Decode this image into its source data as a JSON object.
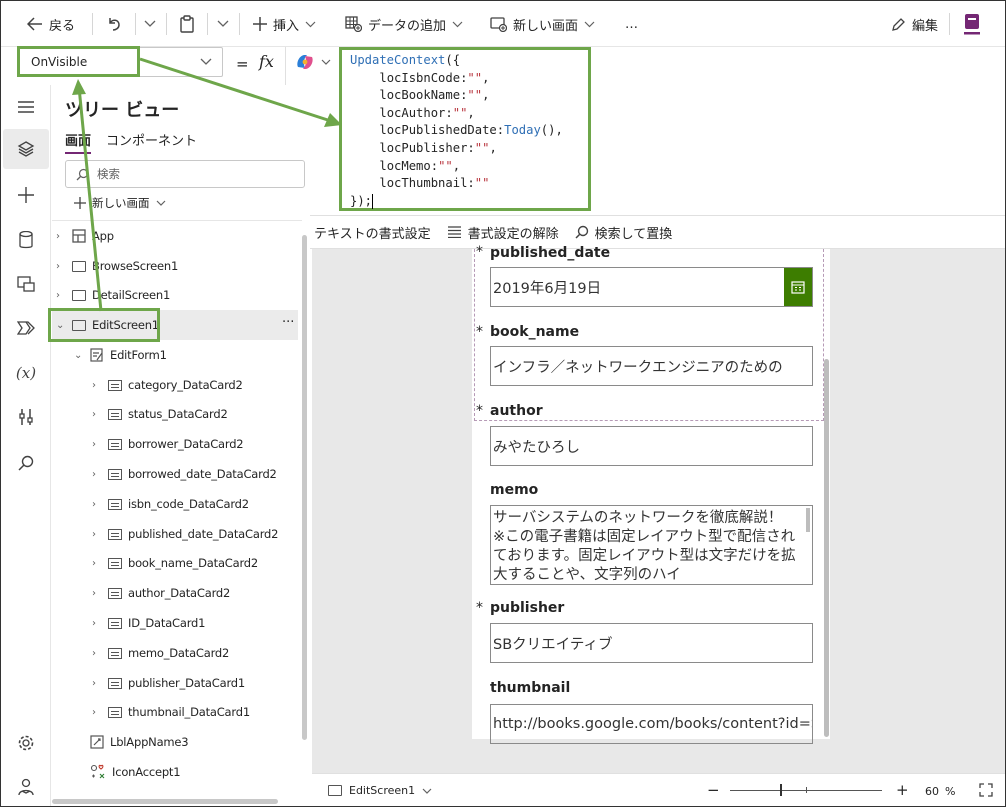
{
  "commandbar": {
    "back": "戻る",
    "insert": "挿入",
    "add_data": "データの追加",
    "new_screen": "新しい画面",
    "more": "…",
    "edit": "編集"
  },
  "formula": {
    "property": "OnVisible",
    "fx": "fx",
    "lines": [
      {
        "fn": "UpdateContext",
        "rest": "({"
      },
      {
        "indent": "    ",
        "key": "locIsbnCode:",
        "val": "\"\"",
        "tail": ","
      },
      {
        "indent": "    ",
        "key": "locBookName:",
        "val": "\"\"",
        "tail": ","
      },
      {
        "indent": "    ",
        "key": "locAuthor:",
        "val": "\"\"",
        "tail": ","
      },
      {
        "indent": "    ",
        "key": "locPublishedDate:",
        "fnval": "Today",
        "tail": "(),"
      },
      {
        "indent": "    ",
        "key": "locPublisher:",
        "val": "\"\"",
        "tail": ","
      },
      {
        "indent": "    ",
        "key": "locMemo:",
        "val": "\"\"",
        "tail": ","
      },
      {
        "indent": "    ",
        "key": "locThumbnail:",
        "val": "\"\"",
        "tail": ""
      },
      {
        "rest": "});"
      }
    ]
  },
  "format_toolbar": {
    "format_text": "テキストの書式設定",
    "remove_format": "書式設定の解除",
    "find_replace": "検索して置換"
  },
  "tree": {
    "title": "ツリー ビュー",
    "tab_screens": "画面",
    "tab_components": "コンポーネント",
    "search_placeholder": "検索",
    "new_screen": "新しい画面",
    "more": "···",
    "nodes": {
      "app": "App",
      "browse": "BrowseScreen1",
      "detail": "DetailScreen1",
      "edit": "EditScreen1",
      "form": "EditForm1",
      "c1": "category_DataCard2",
      "c2": "status_DataCard2",
      "c3": "borrower_DataCard2",
      "c4": "borrowed_date_DataCard2",
      "c5": "isbn_code_DataCard2",
      "c6": "published_date_DataCard2",
      "c7": "book_name_DataCard2",
      "c8": "author_DataCard2",
      "c9": "ID_DataCard1",
      "c10": "memo_DataCard2",
      "c11": "publisher_DataCard1",
      "c12": "thumbnail_DataCard1",
      "lbl": "LblAppName3",
      "icon": "IconAccept1"
    }
  },
  "form": {
    "required_mark": "*",
    "published_date_label": "published_date",
    "published_date_value": "2019年6月19日",
    "book_name_label": "book_name",
    "book_name_value": "インフラ／ネットワークエンジニアのための",
    "author_label": "author",
    "author_value": "みやたひろし",
    "memo_label": "memo",
    "memo_value": "サーバシステムのネットワークを徹底解説！ ※この電子書籍は固定レイアウト型で配信されております。固定レイアウト型は文字だけを拡大することや、文字列のハイ",
    "publisher_label": "publisher",
    "publisher_value": "SBクリエイティブ",
    "thumbnail_label": "thumbnail",
    "thumbnail_value": "http://books.google.com/books/content?id=S"
  },
  "status": {
    "screen": "EditScreen1",
    "minus": "−",
    "plus": "+",
    "zoom": "60",
    "percent": "%"
  },
  "colors": {
    "highlight": "#6ea64a",
    "accent": "#742774",
    "datepicker": "#3d7d00"
  }
}
